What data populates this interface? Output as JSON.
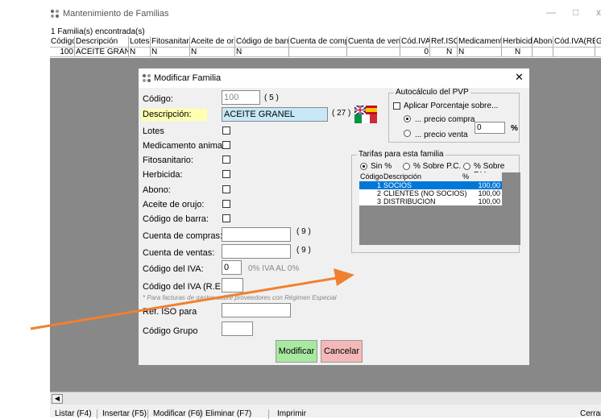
{
  "window": {
    "title": "Mantenimiento de Familias",
    "minimize": "—",
    "maximize": "□",
    "close": "x"
  },
  "count_text": "1 Familia(s) encontrada(s)",
  "grid": {
    "headers": [
      "Código",
      "Descripción",
      "Lotes",
      "Fitosanitario",
      "Aceite de orujo",
      "Código de barras",
      "Cuenta de compras",
      "Cuenta de ventas",
      "Cód.IVA",
      "Ref.ISO",
      "Medicamento",
      "Herbicida",
      "Abono",
      "Cód.IVA(RE)",
      "Gr"
    ],
    "row": [
      "100",
      "ACEITE GRANEL",
      "N",
      "N",
      "N",
      "N",
      "",
      "",
      "0",
      "N",
      "N",
      "N",
      "",
      "",
      ""
    ]
  },
  "bottom_buttons": [
    "Listar (F4)",
    "Insertar (F5)",
    "Modificar (F6)",
    "Eliminar (F7)",
    "Imprimir",
    "Cerrar"
  ],
  "dialog": {
    "title": "Modificar Familia",
    "close": "✕",
    "labels": {
      "codigo": "Código:",
      "descripcion": "Descripción:",
      "lotes": "Lotes",
      "medicamento": "Medicamento animal",
      "fitosanitario": "Fitosanitario:",
      "herbicida": "Herbicida:",
      "abono": "Abono:",
      "aceite": "Aceite de orujo:",
      "codigo_barra": "Código de barra:",
      "cuenta_compras": "Cuenta de compras:",
      "cuenta_ventas": "Cuenta de ventas:",
      "codigo_iva": "Código del IVA:",
      "codigo_iva_re": "Código del IVA (R.E.)*:",
      "nota_re": "* Para facturas de gastos sobre proveedores con Régimen Especial",
      "ref_iso": "Ref. ISO para",
      "codigo_grupo": "Código Grupo"
    },
    "values": {
      "codigo": "100",
      "codigo_len": "( 5 )",
      "descripcion": "ACEITE GRANEL",
      "descripcion_len": "( 27 )",
      "cuenta_compras_len": "( 9 )",
      "cuenta_ventas_len": "( 9 )",
      "codigo_iva": "0",
      "iva_desc": "0% IVA AL 0%",
      "porcentaje": "0",
      "pct_sign": "%"
    },
    "autocalculo": {
      "title": "Autocálculo del PVP",
      "aplicar": "Aplicar Porcentaje sobre...",
      "precio_compra": "... precio compra",
      "precio_venta": "... precio venta"
    },
    "tarifas": {
      "title": "Tarifas para esta familia",
      "options": [
        "Sin %",
        "% Sobre P.C.",
        "% Sobre P.V."
      ],
      "headers": [
        "Código",
        "Descripción",
        "%"
      ],
      "rows": [
        {
          "codigo": "1",
          "descripcion": "SOCIOS",
          "pct": "100,00"
        },
        {
          "codigo": "2",
          "descripcion": "CLIENTES (NO SOCIOS)",
          "pct": "100,00"
        },
        {
          "codigo": "3",
          "descripcion": "DISTRIBUCION",
          "pct": "100,00"
        }
      ]
    },
    "buttons": {
      "modificar": "Modificar",
      "cancelar": "Cancelar"
    }
  },
  "colors": {
    "highlight": "#0078d7",
    "modificar_bg": "#a8e8a0",
    "cancelar_bg": "#f4b8b8",
    "descripcion_label_bg": "#ffffb0",
    "arrow": "#f08030"
  }
}
